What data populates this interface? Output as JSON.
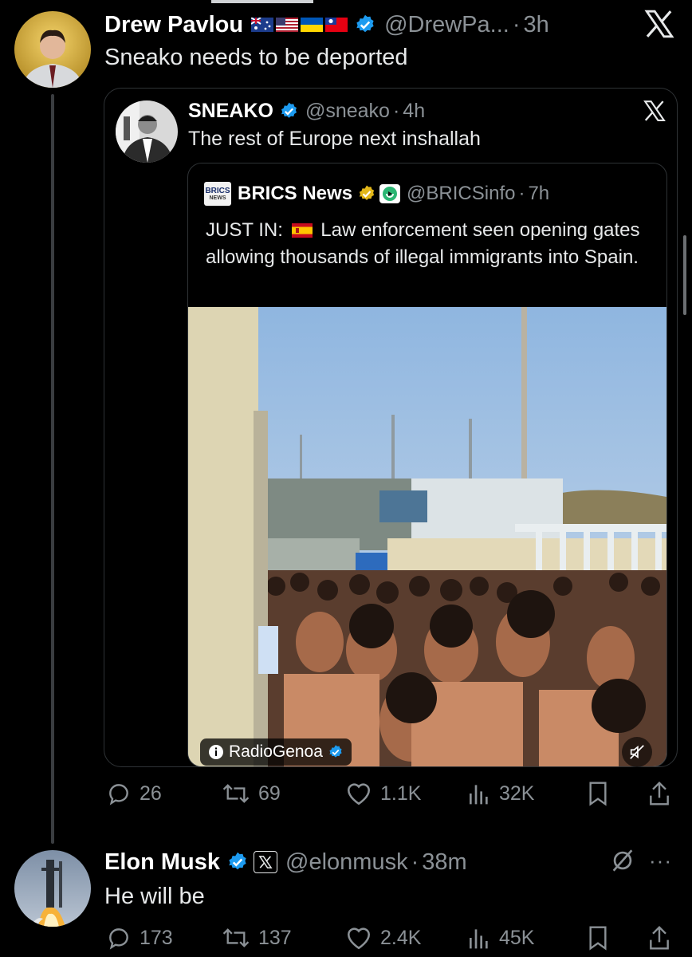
{
  "tweet1": {
    "name": "Drew Pavlou",
    "flags": [
      "AU",
      "US",
      "UA",
      "TW"
    ],
    "handle": "@DrewPa...",
    "time": "3h",
    "text": "Sneako needs to be deported",
    "brand_icon": "x-logo-icon"
  },
  "quote1": {
    "name": "SNEAKO",
    "handle": "@sneako",
    "time": "4h",
    "text": "The rest of Europe next inshallah",
    "brand_icon": "x-logo-icon"
  },
  "quote2": {
    "logo_text": "BRICS",
    "logo_sub": "NEWS",
    "name": "BRICS News",
    "handle": "@BRICSinfo",
    "time": "7h",
    "text_prefix": "JUST IN:",
    "text_body": "Law enforcement seen opening gates allowing thousands of illegal immigrants into Spain.",
    "media_credit": "RadioGenoa"
  },
  "tweet1_actions": {
    "replies": "26",
    "reposts": "69",
    "likes": "1.1K",
    "views": "32K"
  },
  "tweet2": {
    "name": "Elon Musk",
    "handle": "@elonmusk",
    "time": "38m",
    "text": "He will be",
    "actions": {
      "replies": "173",
      "reposts": "137",
      "likes": "2.4K",
      "views": "45K"
    }
  },
  "colors": {
    "background": "#000000",
    "verified_blue": "#1d9bf0",
    "verified_gold": "#e2b719",
    "muted": "#8b9196"
  }
}
